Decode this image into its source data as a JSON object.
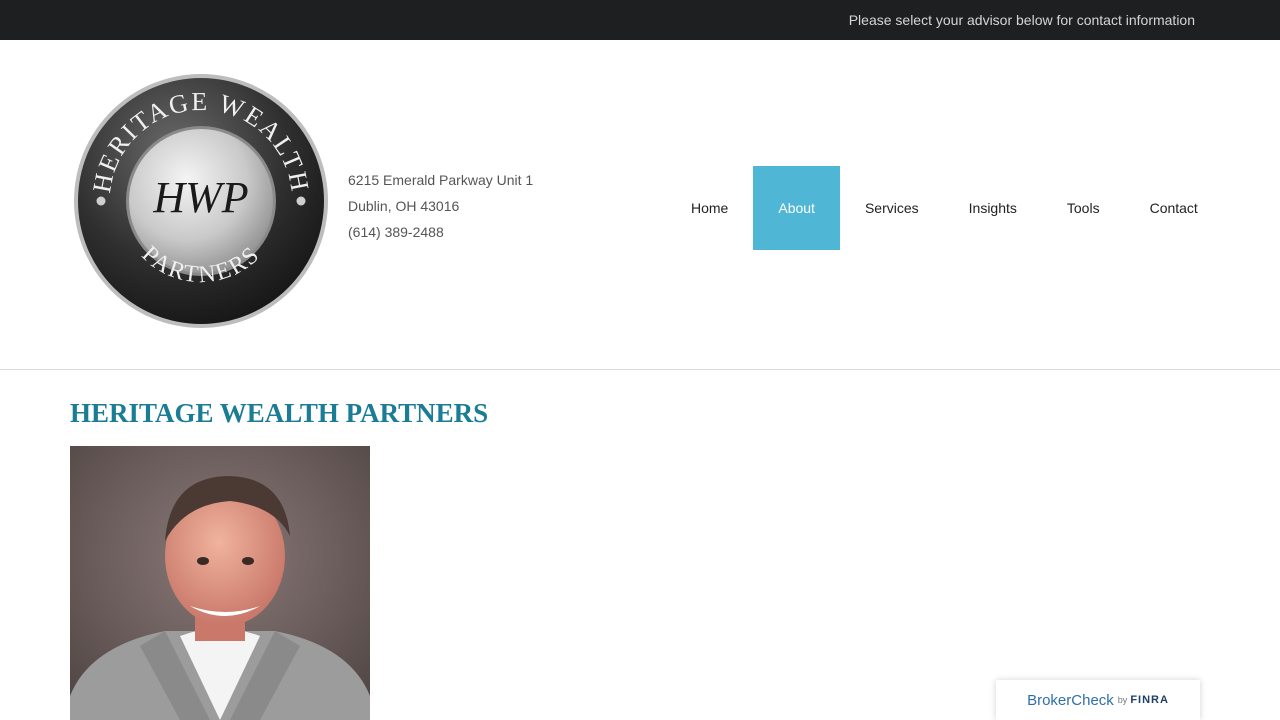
{
  "topbar": {
    "message": "Please select your advisor below for contact information"
  },
  "logo": {
    "top_text": "HERITAGE WEALTH",
    "bottom_text": "PARTNERS",
    "monogram": "HWP"
  },
  "address": {
    "line1": "6215 Emerald Parkway Unit 1",
    "line2": "Dublin, OH 43016",
    "phone": "(614) 389-2488"
  },
  "nav": {
    "items": [
      {
        "label": "Home"
      },
      {
        "label": "About",
        "active": true
      },
      {
        "label": "Services"
      },
      {
        "label": "Insights"
      },
      {
        "label": "Tools"
      },
      {
        "label": "Contact"
      }
    ]
  },
  "main": {
    "title": "HERITAGE WEALTH PARTNERS"
  },
  "brokercheck": {
    "broker": "Broker",
    "check": "Check",
    "by": "by",
    "finra": "FINRA"
  },
  "colors": {
    "accent": "#4fb6d6",
    "title": "#1a7c95",
    "topbar": "#1d1f21"
  }
}
